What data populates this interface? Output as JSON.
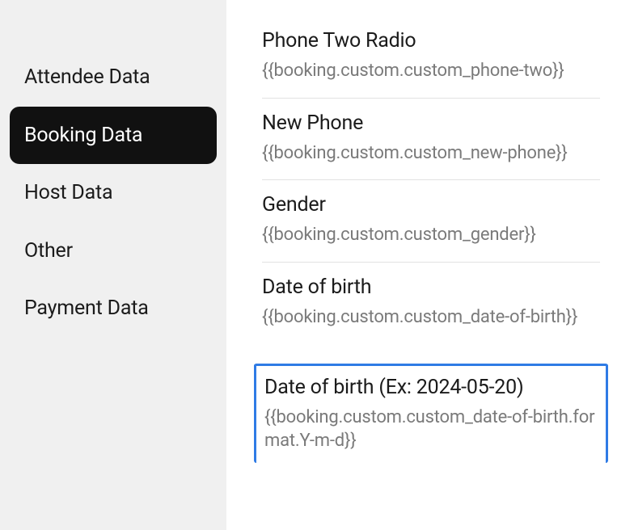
{
  "sidebar": {
    "items": [
      {
        "label": "Attendee Data",
        "key": "attendee"
      },
      {
        "label": "Booking Data",
        "key": "booking",
        "active": true
      },
      {
        "label": "Host Data",
        "key": "host"
      },
      {
        "label": "Other",
        "key": "other"
      },
      {
        "label": "Payment Data",
        "key": "payment"
      }
    ]
  },
  "fields": [
    {
      "label": "Phone Two Radio",
      "code": "{{booking.custom.custom_phone-two}}"
    },
    {
      "label": "New Phone",
      "code": "{{booking.custom.custom_new-phone}}"
    },
    {
      "label": "Gender",
      "code": "{{booking.custom.custom_gender}}"
    },
    {
      "label": "Date of birth",
      "code": "{{booking.custom.custom_date-of-birth}}"
    },
    {
      "label": "Date of birth (Ex: 2024-05-20)",
      "code": "{{booking.custom.custom_date-of-birth.format.Y-m-d}}",
      "selected": true
    }
  ]
}
